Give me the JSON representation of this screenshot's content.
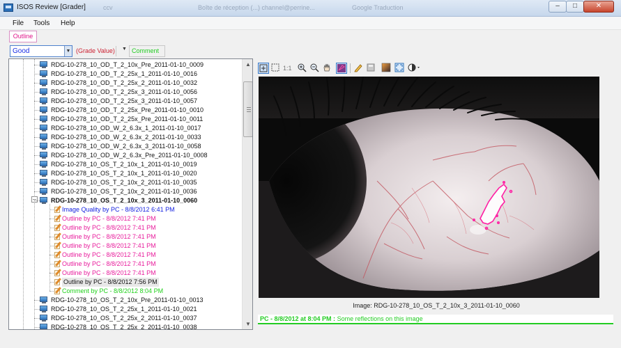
{
  "window": {
    "title": "ISOS Review [Grader]",
    "background_tabs": [
      {
        "label": "ccv"
      },
      {
        "label": "Boîte de réception (...) channel@perrine..."
      },
      {
        "label": "Google Traduction"
      }
    ]
  },
  "menu": {
    "items": [
      "File",
      "Tools",
      "Help"
    ]
  },
  "outline_button": {
    "label": "Outline",
    "color": "#e0158a"
  },
  "grade": {
    "selected": "Good",
    "value_label": "(Grade Value)",
    "comment_label": "Comment"
  },
  "tree": {
    "rows": [
      {
        "kind": "file",
        "label": "RDG-10-278_10_OD_T_2_10x_Pre_2011-01-10_0009"
      },
      {
        "kind": "file",
        "label": "RDG-10-278_10_OD_T_2_25x_1_2011-01-10_0016"
      },
      {
        "kind": "file",
        "label": "RDG-10-278_10_OD_T_2_25x_2_2011-01-10_0032"
      },
      {
        "kind": "file",
        "label": "RDG-10-278_10_OD_T_2_25x_3_2011-01-10_0056"
      },
      {
        "kind": "file",
        "label": "RDG-10-278_10_OD_T_2_25x_3_2011-01-10_0057"
      },
      {
        "kind": "file",
        "label": "RDG-10-278_10_OD_T_2_25x_Pre_2011-01-10_0010"
      },
      {
        "kind": "file",
        "label": "RDG-10-278_10_OD_T_2_25x_Pre_2011-01-10_0011"
      },
      {
        "kind": "file",
        "label": "RDG-10-278_10_OD_W_2_6.3x_1_2011-01-10_0017"
      },
      {
        "kind": "file",
        "label": "RDG-10-278_10_OD_W_2_6.3x_2_2011-01-10_0033"
      },
      {
        "kind": "file",
        "label": "RDG-10-278_10_OD_W_2_6.3x_3_2011-01-10_0058"
      },
      {
        "kind": "file",
        "label": "RDG-10-278_10_OD_W_2_6.3x_Pre_2011-01-10_0008"
      },
      {
        "kind": "file",
        "label": "RDG-10-278_10_OS_T_2_10x_1_2011-01-10_0019"
      },
      {
        "kind": "file",
        "label": "RDG-10-278_10_OS_T_2_10x_1_2011-01-10_0020"
      },
      {
        "kind": "file",
        "label": "RDG-10-278_10_OS_T_2_10x_2_2011-01-10_0035"
      },
      {
        "kind": "file",
        "label": "RDG-10-278_10_OS_T_2_10x_2_2011-01-10_0036"
      },
      {
        "kind": "file-open",
        "label": "RDG-10-278_10_OS_T_2_10x_3_2011-01-10_0060"
      },
      {
        "kind": "quality",
        "label": "Image Quality by PC - 8/8/2012 6:41 PM"
      },
      {
        "kind": "outline",
        "label": "Outline by PC - 8/8/2012 7:41 PM"
      },
      {
        "kind": "outline",
        "label": "Outline by PC - 8/8/2012 7:41 PM"
      },
      {
        "kind": "outline",
        "label": "Outline by PC - 8/8/2012 7:41 PM"
      },
      {
        "kind": "outline",
        "label": "Outline by PC - 8/8/2012 7:41 PM"
      },
      {
        "kind": "outline",
        "label": "Outline by PC - 8/8/2012 7:41 PM"
      },
      {
        "kind": "outline",
        "label": "Outline by PC - 8/8/2012 7:41 PM"
      },
      {
        "kind": "outline",
        "label": "Outline by PC - 8/8/2012 7:41 PM"
      },
      {
        "kind": "outline-selected",
        "label": "Outline by PC - 8/8/2012 7:56 PM"
      },
      {
        "kind": "comment",
        "label": "Comment by PC - 8/8/2012 8:04 PM"
      },
      {
        "kind": "file",
        "label": "RDG-10-278_10_OS_T_2_10x_Pre_2011-01-10_0013"
      },
      {
        "kind": "file",
        "label": "RDG-10-278_10_OS_T_2_25x_1_2011-01-10_0021"
      },
      {
        "kind": "file",
        "label": "RDG-10-278_10_OS_T_2_25x_2_2011-01-10_0037"
      },
      {
        "kind": "file",
        "label": "RDG-10-278_10_OS_T_2_25x_2_2011-01-10_0038"
      }
    ]
  },
  "viewer": {
    "zoom_label": "1:1",
    "tool_icons": [
      "fit-window-icon",
      "select-rect-icon",
      "zoom-in-icon",
      "zoom-out-icon",
      "pan-hand-icon",
      "outline-overlay-icon",
      "pencil-icon",
      "save-icon",
      "color-adjust-icon",
      "fullscreen-icon",
      "contrast-icon"
    ],
    "caption": "Image: RDG-10-278_10_OS_T_2_10x_3_2011-01-10_0060",
    "comment_author": "PC - 8/8/2012 at 8:04 PM :",
    "comment_text": "Some reflections on this image"
  },
  "colors": {
    "quality": "#1522e0",
    "outline": "#e81c9c",
    "comment": "#22d11d",
    "accent": "#3a79c5"
  }
}
